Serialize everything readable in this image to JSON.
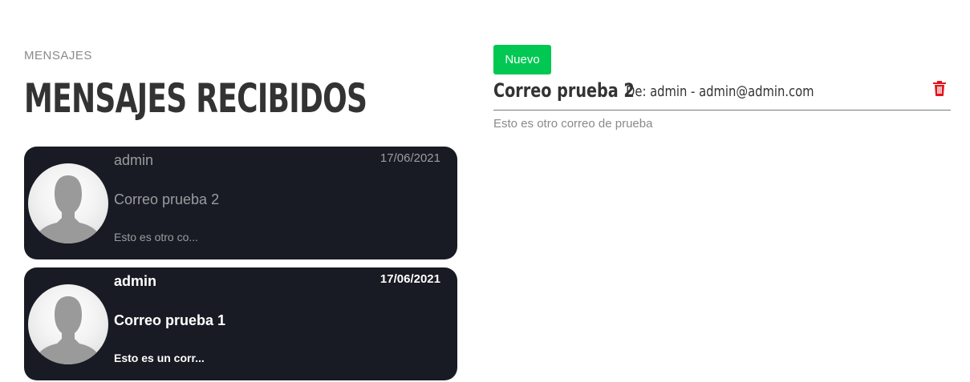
{
  "breadcrumb": "MENSAJES",
  "page_title": "MENSAJES RECIBIDOS",
  "messages": [
    {
      "sender": "admin",
      "date": "17/06/2021",
      "subject": "Correo prueba 2",
      "preview": "Esto es otro co...",
      "state": "read"
    },
    {
      "sender": "admin",
      "date": "17/06/2021",
      "subject": "Correo prueba 1",
      "preview": "Esto es un corr...",
      "state": "unread"
    }
  ],
  "detail": {
    "badge": "Nuevo",
    "subject": "Correo prueba 2",
    "from": "De: admin - admin@admin.com",
    "body": "Esto es otro correo de prueba",
    "delete_icon": "trash-icon"
  },
  "colors": {
    "card_background": "#181b23",
    "badge_green": "#00c853",
    "delete_red": "#e0141e"
  }
}
